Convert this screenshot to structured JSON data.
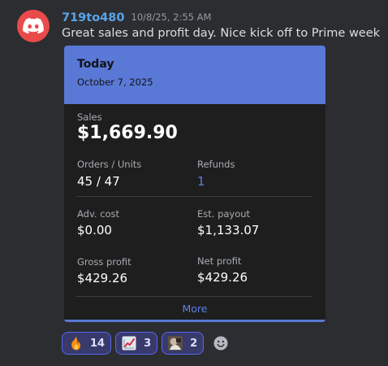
{
  "message": {
    "username": "719to480",
    "timestamp": "10/8/25, 2:55 AM",
    "text": "Great sales and profit day. Nice kick off to Prime week",
    "avatar_icon": "discord-logo-icon",
    "avatar_color": "#ea4b4a"
  },
  "card": {
    "title": "Today",
    "date": "October 7, 2025",
    "accent_color": "#5a78d6",
    "sales": {
      "label": "Sales",
      "value": "$1,669.90"
    },
    "orders_units": {
      "label": "Orders / Units",
      "value": "45 / 47"
    },
    "refunds": {
      "label": "Refunds",
      "value": "1"
    },
    "adv_cost": {
      "label": "Adv. cost",
      "value": "$0.00"
    },
    "est_payout": {
      "label": "Est. payout",
      "value": "$1,133.07"
    },
    "gross_profit": {
      "label": "Gross profit",
      "value": "$429.26"
    },
    "net_profit": {
      "label": "Net profit",
      "value": "$429.26"
    },
    "more_label": "More"
  },
  "reactions": [
    {
      "emoji": "fire-emoji-icon",
      "count": "14"
    },
    {
      "emoji": "chart-increasing-emoji-icon",
      "count": "3"
    },
    {
      "emoji": "custom-emoji-icon",
      "count": "2"
    }
  ],
  "add_reaction_icon": "add-reaction-smile-icon"
}
